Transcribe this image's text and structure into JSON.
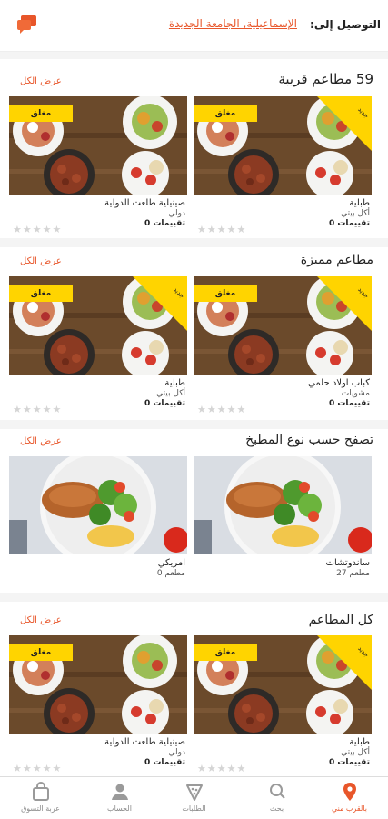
{
  "header": {
    "deliver_label": "التوصيل إلى:",
    "address": "الإسماعيلية, الجامعة الجديدة",
    "chat_icon": "chat-bubble-icon",
    "accent": "#e8562a"
  },
  "sections": [
    {
      "title": "59 مطاعم قريبة",
      "view_all": "عرض الكل",
      "cards": [
        {
          "name": "طبلية",
          "category": "أكل بيتي",
          "rating": "تقييمات 0",
          "badge": "مغلق",
          "ribbon": "جديد"
        },
        {
          "name": "صينيلية طلعت الدولية",
          "category": "دولي",
          "rating": "تقييمات 0",
          "badge": "مغلق"
        }
      ]
    },
    {
      "title": "مطاعم مميزة",
      "view_all": "عرض الكل",
      "cards": [
        {
          "name": "كباب اولاد حلمي",
          "category": "مشويات",
          "rating": "تقييمات 0",
          "badge": "مغلق",
          "ribbon": "جديد"
        },
        {
          "name": "طبلية",
          "category": "أكل بيتي",
          "rating": "تقييمات 0",
          "badge": "مغلق",
          "ribbon": "جديد"
        }
      ]
    },
    {
      "title": "تصفح حسب نوع المطبخ",
      "view_all": "عرض الكل",
      "cuisines": [
        {
          "name": "ساندوتشات",
          "count": "مطعم 27"
        },
        {
          "name": "امريكي",
          "count": "مطعم 0"
        }
      ]
    },
    {
      "title": "كل المطاعم",
      "view_all": "عرض الكل",
      "cards": [
        {
          "name": "طبلية",
          "category": "أكل بيتي",
          "rating": "تقييمات 0",
          "badge": "مغلق",
          "ribbon": "جديد"
        },
        {
          "name": "صينيلية طلعت الدولية",
          "category": "دولي",
          "rating": "تقييمات 0",
          "badge": "مغلق"
        }
      ]
    }
  ],
  "bottom_nav": [
    {
      "label": "بالقرب مني",
      "icon": "location-pin-icon",
      "active": true
    },
    {
      "label": "بحث",
      "icon": "search-icon"
    },
    {
      "label": "الطلبات",
      "icon": "pizza-slice-icon"
    },
    {
      "label": "الحساب",
      "icon": "user-icon"
    },
    {
      "label": "عربة التسوق",
      "icon": "shopping-bag-icon"
    }
  ],
  "stars": "★★★★★"
}
